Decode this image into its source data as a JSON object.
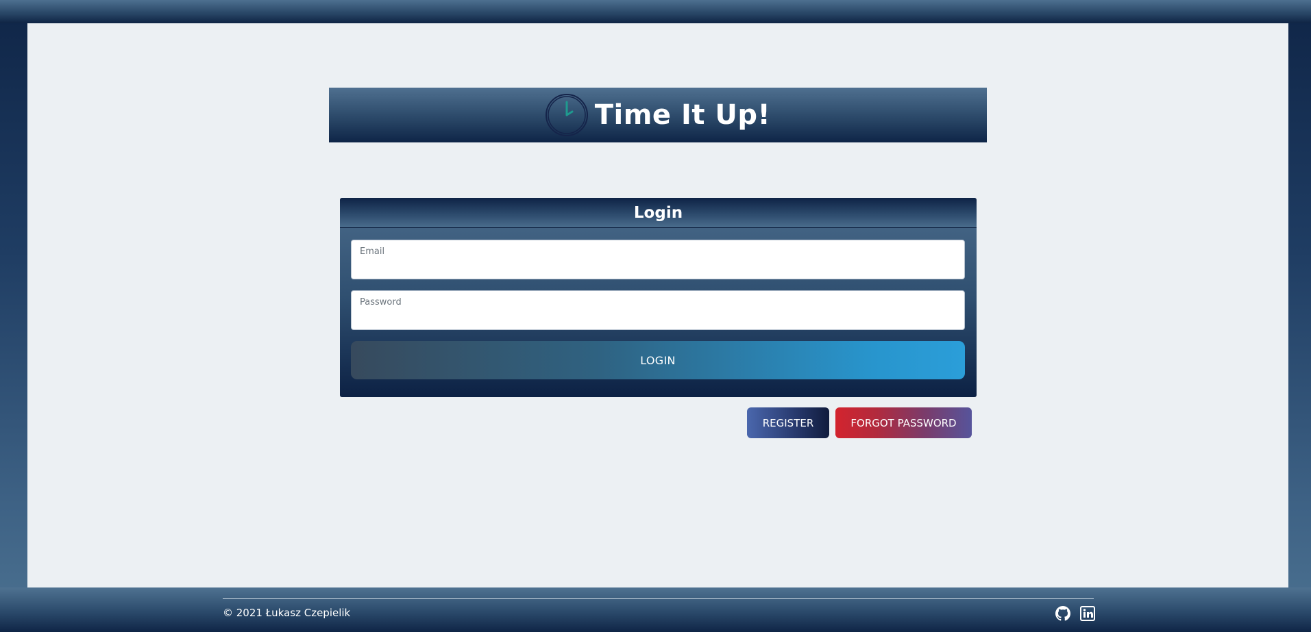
{
  "app": {
    "title": "Time It Up!",
    "logo_icon": "clock-icon"
  },
  "login": {
    "heading": "Login",
    "email_label": "Email",
    "password_label": "Password",
    "submit_label": "LOGIN"
  },
  "actions": {
    "register_label": "REGISTER",
    "forgot_label": "FORGOT PASSWORD"
  },
  "footer": {
    "copyright": "© 2021 Łukasz Czepielik",
    "icons": [
      "github-icon",
      "linkedin-icon"
    ]
  },
  "colors": {
    "navy": "#0f2547",
    "steel": "#4c7291",
    "content_bg": "#ecf0f3",
    "accent_blue": "#2b9ed9",
    "danger_red": "#d3242e",
    "clock_hand": "#1f9a8f"
  }
}
